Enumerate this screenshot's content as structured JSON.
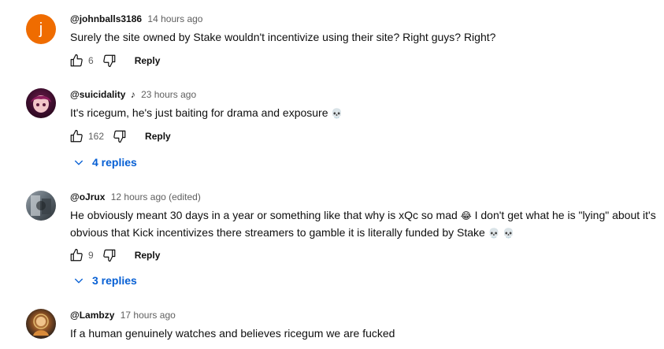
{
  "comments": [
    {
      "avatar_letter": "j",
      "handle": "@johnballs3186",
      "time": "14 hours ago",
      "text": "Surely the site owned by Stake wouldn't incentivize using their site? Right guys? Right?",
      "likes": "6",
      "reply_label": "Reply"
    },
    {
      "handle": "@suicidality",
      "badge": "♪",
      "time": "23 hours ago",
      "text": "It's ricegum, he's just baiting for drama and exposure",
      "emoji": "💀",
      "likes": "162",
      "reply_label": "Reply",
      "replies_label": "4 replies"
    },
    {
      "handle": "@oJrux",
      "time": "12 hours ago (edited)",
      "text_part1": "He obviously meant 30 days in a year or something like that why is xQc so mad",
      "emoji_mid": "😂",
      "text_part2": "I don't get what he is \"lying\" about it's obvious that Kick incentivizes there streamers to gamble it is literally funded by Stake",
      "emoji_end": "💀 💀",
      "likes": "9",
      "reply_label": "Reply",
      "replies_label": "3 replies"
    },
    {
      "handle": "@Lambzy",
      "time": "17 hours ago",
      "text": "If a human genuinely watches and believes ricegum we are fucked"
    }
  ],
  "icons": [
    "thumb-up-icon",
    "thumb-down-icon",
    "chevron-down-icon",
    "music-note-icon",
    "skull-emoji",
    "laughing-emoji"
  ],
  "colors": {
    "link": "#065fd4",
    "meta": "#606060",
    "avatar_orange": "#ef6c00"
  }
}
